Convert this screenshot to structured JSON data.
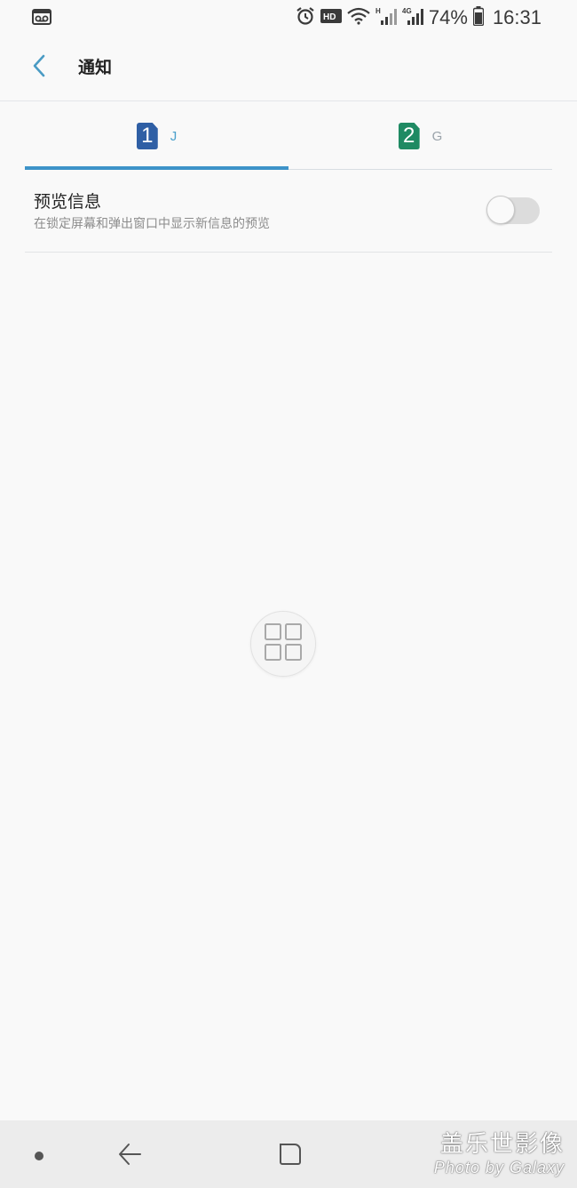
{
  "status_bar": {
    "left_icon": "voicemail-icon",
    "icons": [
      "alarm-icon",
      "hd-voice-icon",
      "wifi-icon",
      "signal-h-icon",
      "signal-4g-icon",
      "battery-icon"
    ],
    "hd_text": "HD",
    "h_text": "H",
    "lte_text": "4G",
    "battery": "74%",
    "time": "16:31"
  },
  "header": {
    "back_icon": "chevron-left-icon",
    "title": "通知"
  },
  "sim_tabs": [
    {
      "number": "1",
      "label": "J",
      "active": true,
      "color": "#2f5fa5"
    },
    {
      "number": "2",
      "label": "G",
      "active": false,
      "color": "#1f8a63"
    }
  ],
  "accent_color": "#3d93c9",
  "setting": {
    "title": "预览信息",
    "description": "在锁定屏幕和弹出窗口中显示新信息的预览",
    "toggle_on": false
  },
  "floating_button": {
    "icon": "grid-icon"
  },
  "nav_bar": {
    "buttons": [
      "dot-icon",
      "back-arrow-icon",
      "recents-icon"
    ]
  },
  "watermark": {
    "line1": "盖乐世影像",
    "line2": "Photo by Galaxy"
  }
}
